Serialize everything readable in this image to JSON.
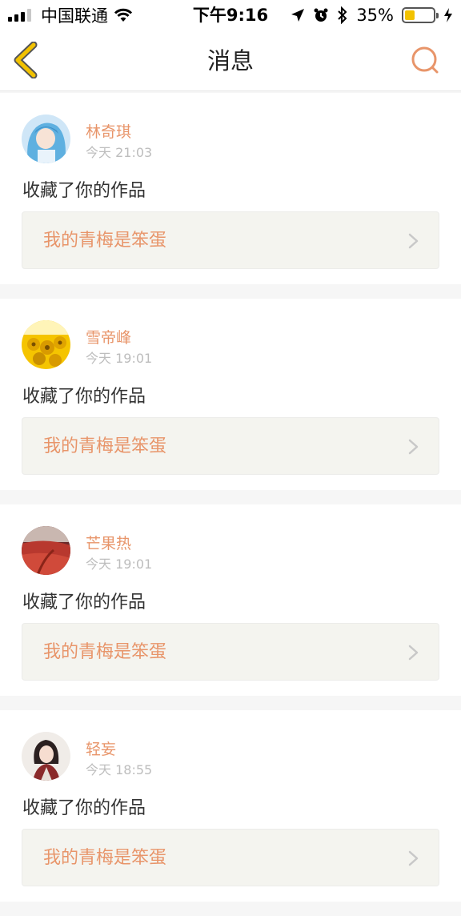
{
  "status_bar": {
    "carrier": "中国联通",
    "time": "下午9:16",
    "battery": "35%",
    "battery_level": 0.35
  },
  "nav": {
    "title": "消息"
  },
  "messages": [
    {
      "username": "林奇琪",
      "time": "今天 21:03",
      "action": "收藏了你的作品",
      "work_title": "我的青梅是笨蛋",
      "avatar": "anime-girl-blue-hair-avatar"
    },
    {
      "username": "雪帝峰",
      "time": "今天 19:01",
      "action": "收藏了你的作品",
      "work_title": "我的青梅是笨蛋",
      "avatar": "sunflower-avatar"
    },
    {
      "username": "芒果热",
      "time": "今天 19:01",
      "action": "收藏了你的作品",
      "work_title": "我的青梅是笨蛋",
      "avatar": "red-landscape-avatar"
    },
    {
      "username": "轻妄",
      "time": "今天 18:55",
      "action": "收藏了你的作品",
      "work_title": "我的青梅是笨蛋",
      "avatar": "anime-character-dark-hair-avatar"
    }
  ],
  "colors": {
    "accent": "#e8956a",
    "back_arrow": "#f2c200",
    "work_box_bg": "#f4f4ef"
  }
}
